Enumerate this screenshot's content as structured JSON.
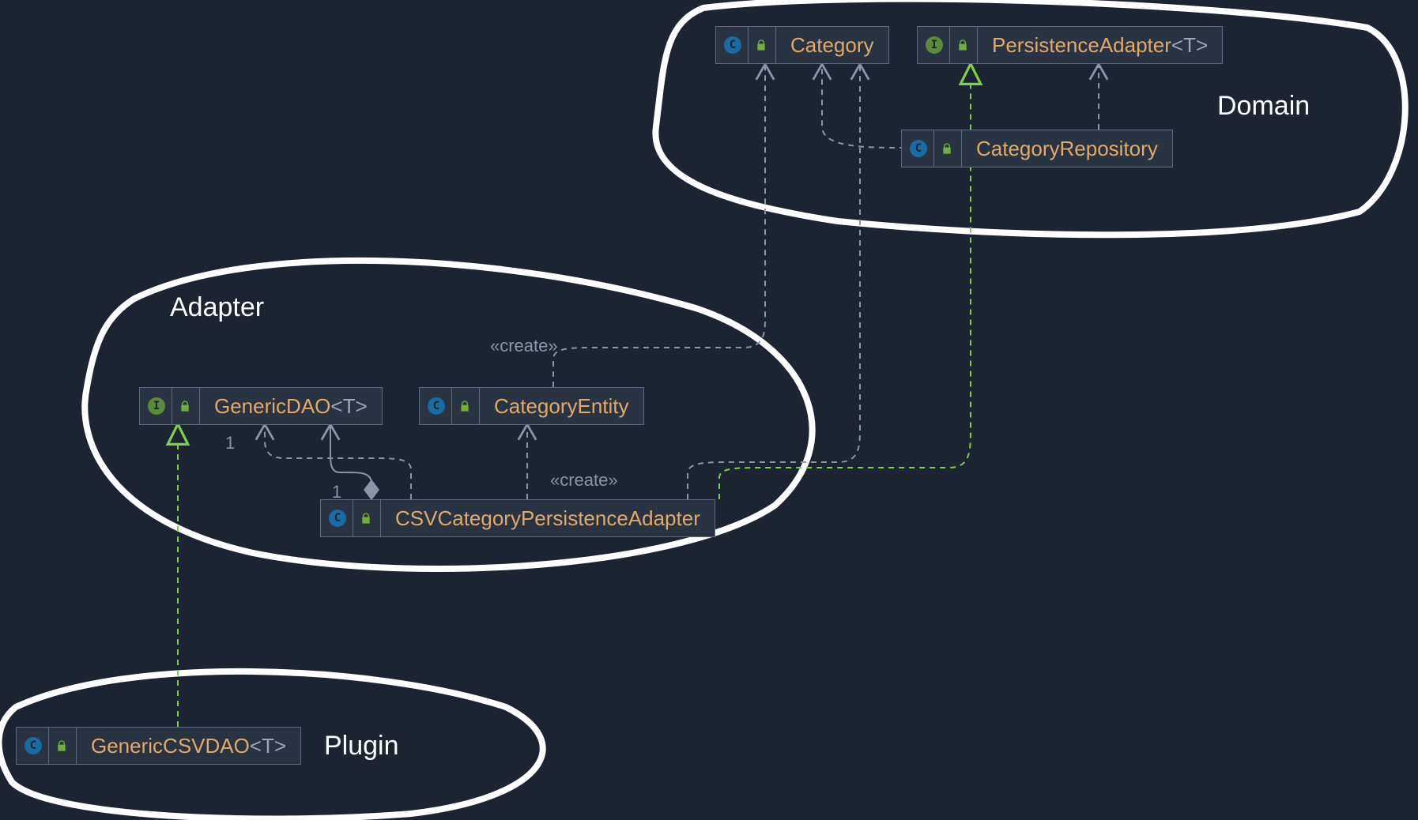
{
  "groups": {
    "domain": "Domain",
    "adapter": "Adapter",
    "plugin": "Plugin"
  },
  "nodes": {
    "category": {
      "kind": "class",
      "name": "Category",
      "generic": ""
    },
    "persistenceAdapter": {
      "kind": "interface",
      "name": "PersistenceAdapter",
      "generic": "<T>"
    },
    "categoryRepository": {
      "kind": "class",
      "name": "CategoryRepository",
      "generic": ""
    },
    "genericDAO": {
      "kind": "interface",
      "name": "GenericDAO",
      "generic": "<T>"
    },
    "categoryEntity": {
      "kind": "class",
      "name": "CategoryEntity",
      "generic": ""
    },
    "csvCatAdapter": {
      "kind": "class",
      "name": "CSVCategoryPersistenceAdapter",
      "generic": ""
    },
    "genericCSVDAO": {
      "kind": "class",
      "name": "GenericCSVDAO",
      "generic": "<T>"
    }
  },
  "edgeLabels": {
    "create1": "«create»",
    "create2": "«create»",
    "one_a": "1",
    "one_b": "1"
  },
  "chart_data": {
    "type": "uml-class-dependency",
    "groups": [
      {
        "name": "Domain",
        "members": [
          "Category",
          "PersistenceAdapter<T>",
          "CategoryRepository"
        ]
      },
      {
        "name": "Adapter",
        "members": [
          "GenericDAO<T>",
          "CategoryEntity",
          "CSVCategoryPersistenceAdapter"
        ]
      },
      {
        "name": "Plugin",
        "members": [
          "GenericCSVDAO<T>"
        ]
      }
    ],
    "nodes": [
      {
        "id": "Category",
        "stereotype": "class"
      },
      {
        "id": "PersistenceAdapter<T>",
        "stereotype": "interface"
      },
      {
        "id": "CategoryRepository",
        "stereotype": "class"
      },
      {
        "id": "GenericDAO<T>",
        "stereotype": "interface"
      },
      {
        "id": "CategoryEntity",
        "stereotype": "class"
      },
      {
        "id": "CSVCategoryPersistenceAdapter",
        "stereotype": "class"
      },
      {
        "id": "GenericCSVDAO<T>",
        "stereotype": "class"
      }
    ],
    "edges": [
      {
        "from": "CategoryRepository",
        "to": "Category",
        "type": "dependency"
      },
      {
        "from": "CategoryRepository",
        "to": "PersistenceAdapter<T>",
        "type": "dependency"
      },
      {
        "from": "CategoryEntity",
        "to": "Category",
        "type": "dependency",
        "label": "«create»"
      },
      {
        "from": "CSVCategoryPersistenceAdapter",
        "to": "CategoryEntity",
        "type": "dependency",
        "label": "«create»"
      },
      {
        "from": "CSVCategoryPersistenceAdapter",
        "to": "Category",
        "type": "dependency"
      },
      {
        "from": "CSVCategoryPersistenceAdapter",
        "to": "PersistenceAdapter<T>",
        "type": "realization"
      },
      {
        "from": "CSVCategoryPersistenceAdapter",
        "to": "GenericDAO<T>",
        "type": "dependency",
        "multiplicity": "1"
      },
      {
        "from": "CSVCategoryPersistenceAdapter",
        "to": "GenericDAO<T>",
        "type": "aggregation",
        "multiplicity": "1"
      },
      {
        "from": "GenericCSVDAO<T>",
        "to": "GenericDAO<T>",
        "type": "realization"
      }
    ]
  }
}
